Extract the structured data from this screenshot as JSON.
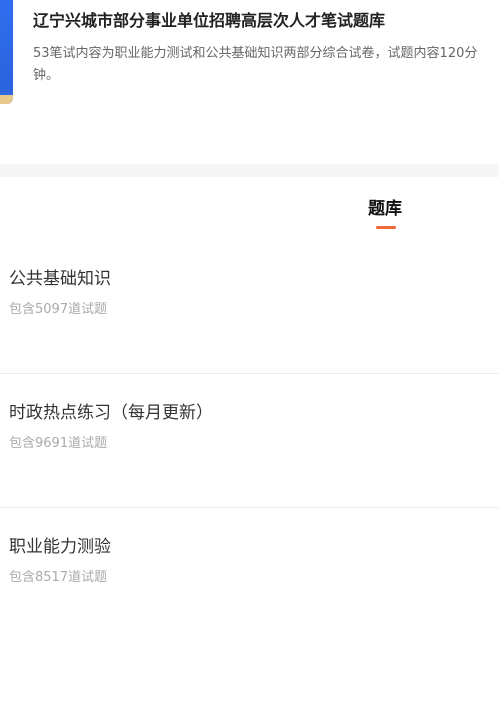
{
  "header": {
    "title": "辽宁兴城市部分事业单位招聘高层次人才笔试题库",
    "description": "53笔试内容为职业能力测试和公共基础知识两部分综合试卷，试题内容120分钟。",
    "cover_color": "#2f6ff0"
  },
  "tabs": [
    {
      "label": "题库",
      "active": true,
      "accent_color": "#f0673a"
    }
  ],
  "question_banks": [
    {
      "name": "公共基础知识",
      "count_text": "包含5097道试题"
    },
    {
      "name": "时政热点练习（每月更新）",
      "count_text": "包含9691道试题"
    },
    {
      "name": "职业能力测验",
      "count_text": "包含8517道试题"
    }
  ]
}
